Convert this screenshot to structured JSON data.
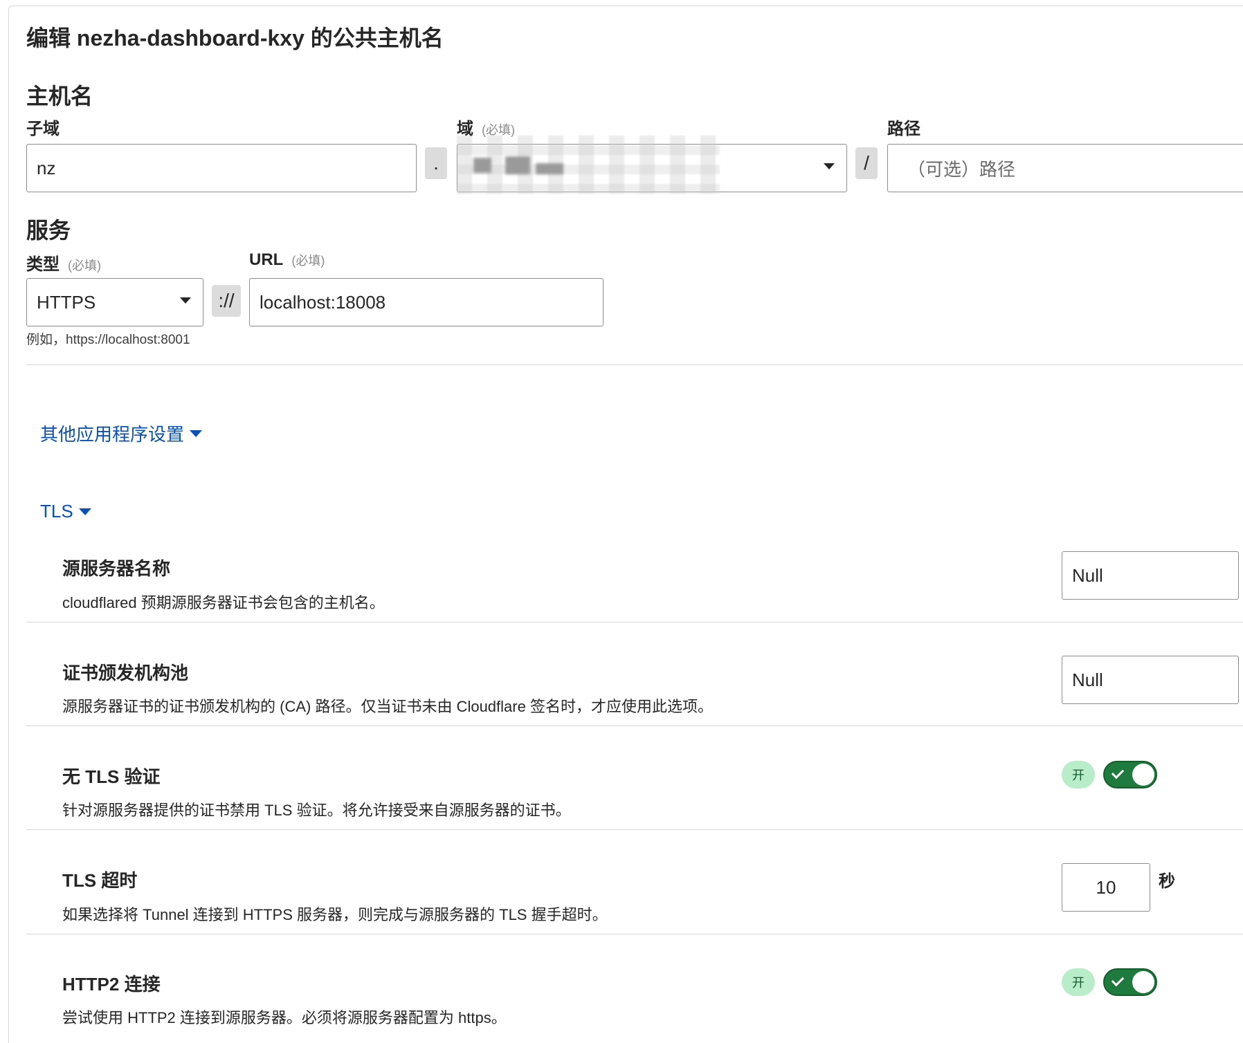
{
  "header": {
    "title": "编辑 nezha-dashboard-kxy 的公共主机名"
  },
  "hostname": {
    "section_title": "主机名",
    "subdomain": {
      "label": "子域",
      "value": "nz"
    },
    "domain": {
      "label": "域",
      "required": "(必填)"
    },
    "dot": ".",
    "slash": "/",
    "path": {
      "label": "路径",
      "placeholder": "（可选）路径"
    }
  },
  "service": {
    "section_title": "服务",
    "type": {
      "label": "类型",
      "required": "(必填)",
      "value": "HTTPS"
    },
    "scheme_sep": "://",
    "url": {
      "label": "URL",
      "required": "(必填)",
      "value": "localhost:18008"
    },
    "hint": "例如，https://localhost:8001"
  },
  "links": {
    "other_settings": "其他应用程序设置",
    "tls": "TLS"
  },
  "tls_settings": [
    {
      "title": "源服务器名称",
      "desc": "cloudflared 预期源服务器证书会包含的主机名。",
      "value": "Null"
    },
    {
      "title": "证书颁发机构池",
      "desc": "源服务器证书的证书颁发机构的 (CA) 路径。仅当证书未由 Cloudflare 签名时，才应使用此选项。",
      "value": "Null"
    },
    {
      "title": "无 TLS 验证",
      "desc": "针对源服务器提供的证书禁用 TLS 验证。将允许接受来自源服务器的证书。",
      "badge": "开",
      "enabled": true
    },
    {
      "title": "TLS 超时",
      "desc": "如果选择将 Tunnel 连接到 HTTPS 服务器，则完成与源服务器的 TLS 握手超时。",
      "value": "10",
      "unit": "秒"
    },
    {
      "title": "HTTP2 连接",
      "desc": "尝试使用 HTTP2 连接到源服务器。必须将源服务器配置为 https。",
      "badge": "开",
      "enabled": true
    }
  ],
  "colors": {
    "link": "#0a51b5",
    "toggle_on": "#1f7a3d",
    "badge_bg": "#b9ecc8"
  }
}
